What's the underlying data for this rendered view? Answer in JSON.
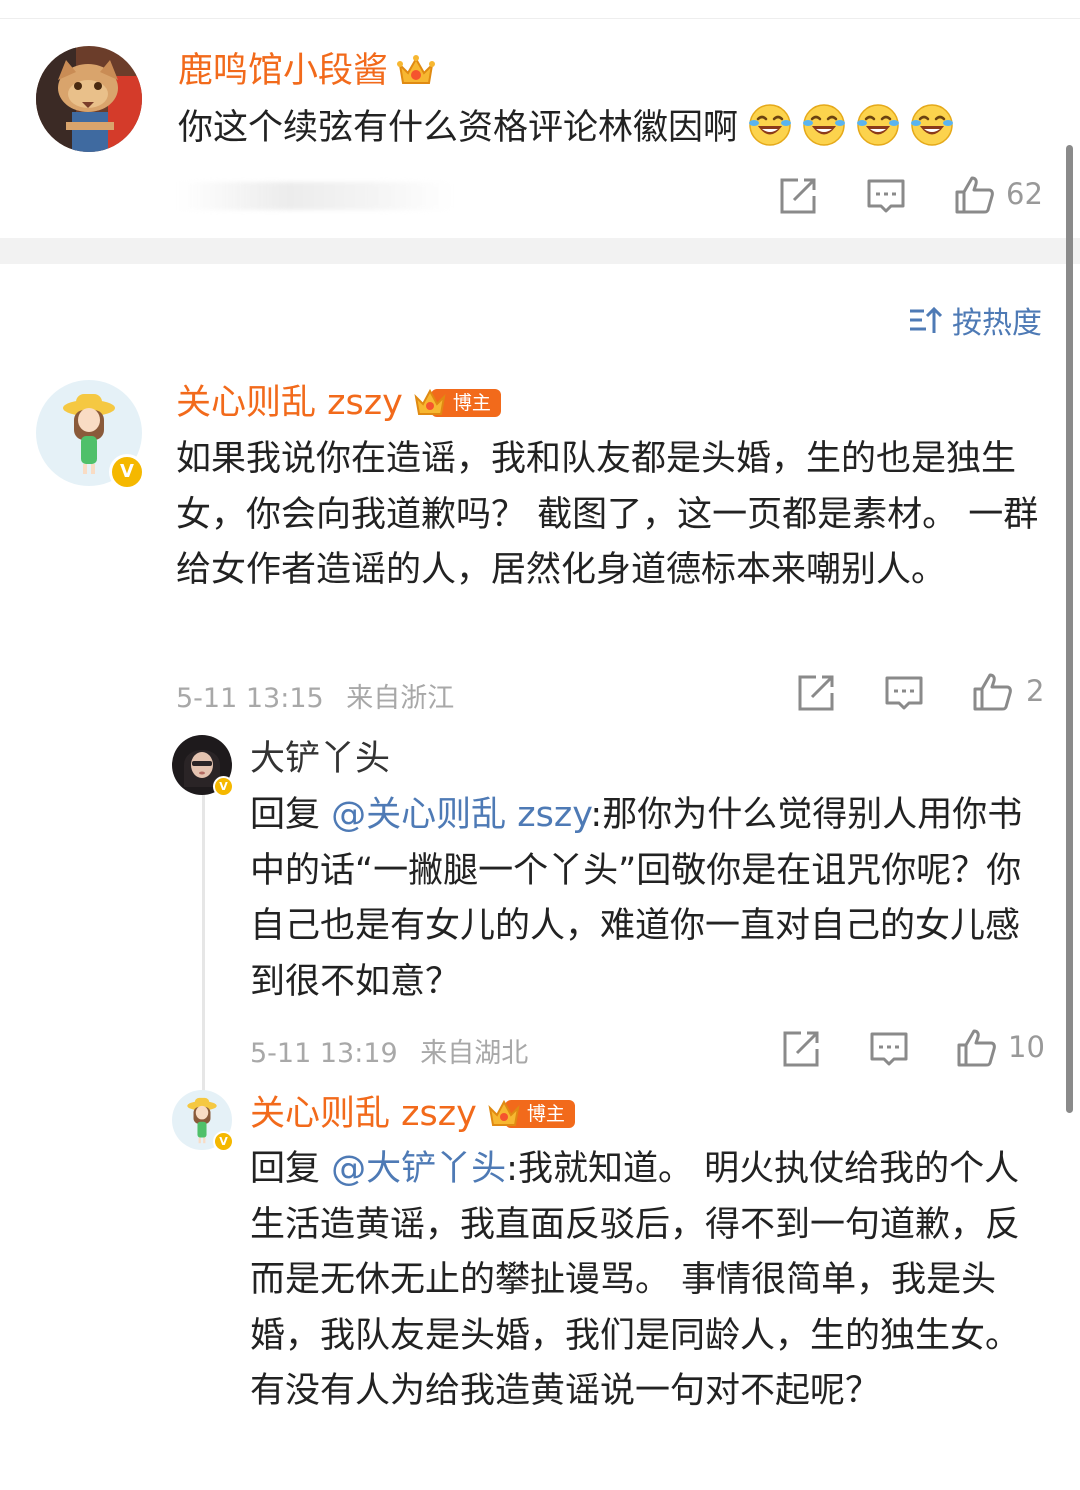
{
  "comment1": {
    "username": "鹿鸣馆小段酱",
    "text": "你这个续弦有什么资格评论林徽因啊",
    "likes": "62",
    "emoji_icon": "laughing-crying-emoji"
  },
  "sort": {
    "label": "按热度"
  },
  "comment2": {
    "username": "关心则乱 zszy",
    "tag": "博主",
    "text": "如果我说你在造谣，我和队友都是头婚，生的也是独生女，你会向我道歉吗？ 截图了，这一页都是素材。 一群给女作者造谣的人，居然化身道德标本来嘲别人。",
    "time": "5-11 13:15",
    "location": "来自浙江",
    "likes": "2"
  },
  "reply1": {
    "username": "大铲丫头",
    "prefix": "回复 ",
    "mention": "@关心则乱 zszy",
    "text": ":那你为什么觉得别人用你书中的话“一撇腿一个丫头”回敬你是在诅咒你呢？你自己也是有女儿的人，难道你一直对自己的女儿感到很不如意？",
    "time": "5-11 13:19",
    "location": "来自湖北",
    "likes": "10"
  },
  "reply2": {
    "username": "关心则乱 zszy",
    "tag": "博主",
    "prefix": "回复 ",
    "mention": "@大铲丫头",
    "text": ":我就知道。 明火执仗给我的个人生活造黄谣，我直面反驳后，得不到一句道歉，反而是无休无止的攀扯谩骂。 事情很简单，我是头婚，我队友是头婚，我们是同龄人，生的独生女。 有没有人为给我造黄谣说一句对不起呢？"
  },
  "colors": {
    "username_orange": "#f26a1b",
    "link_blue": "#4e7ab5",
    "meta_gray": "#a8a8a8",
    "verified_gold": "#f5b800"
  }
}
